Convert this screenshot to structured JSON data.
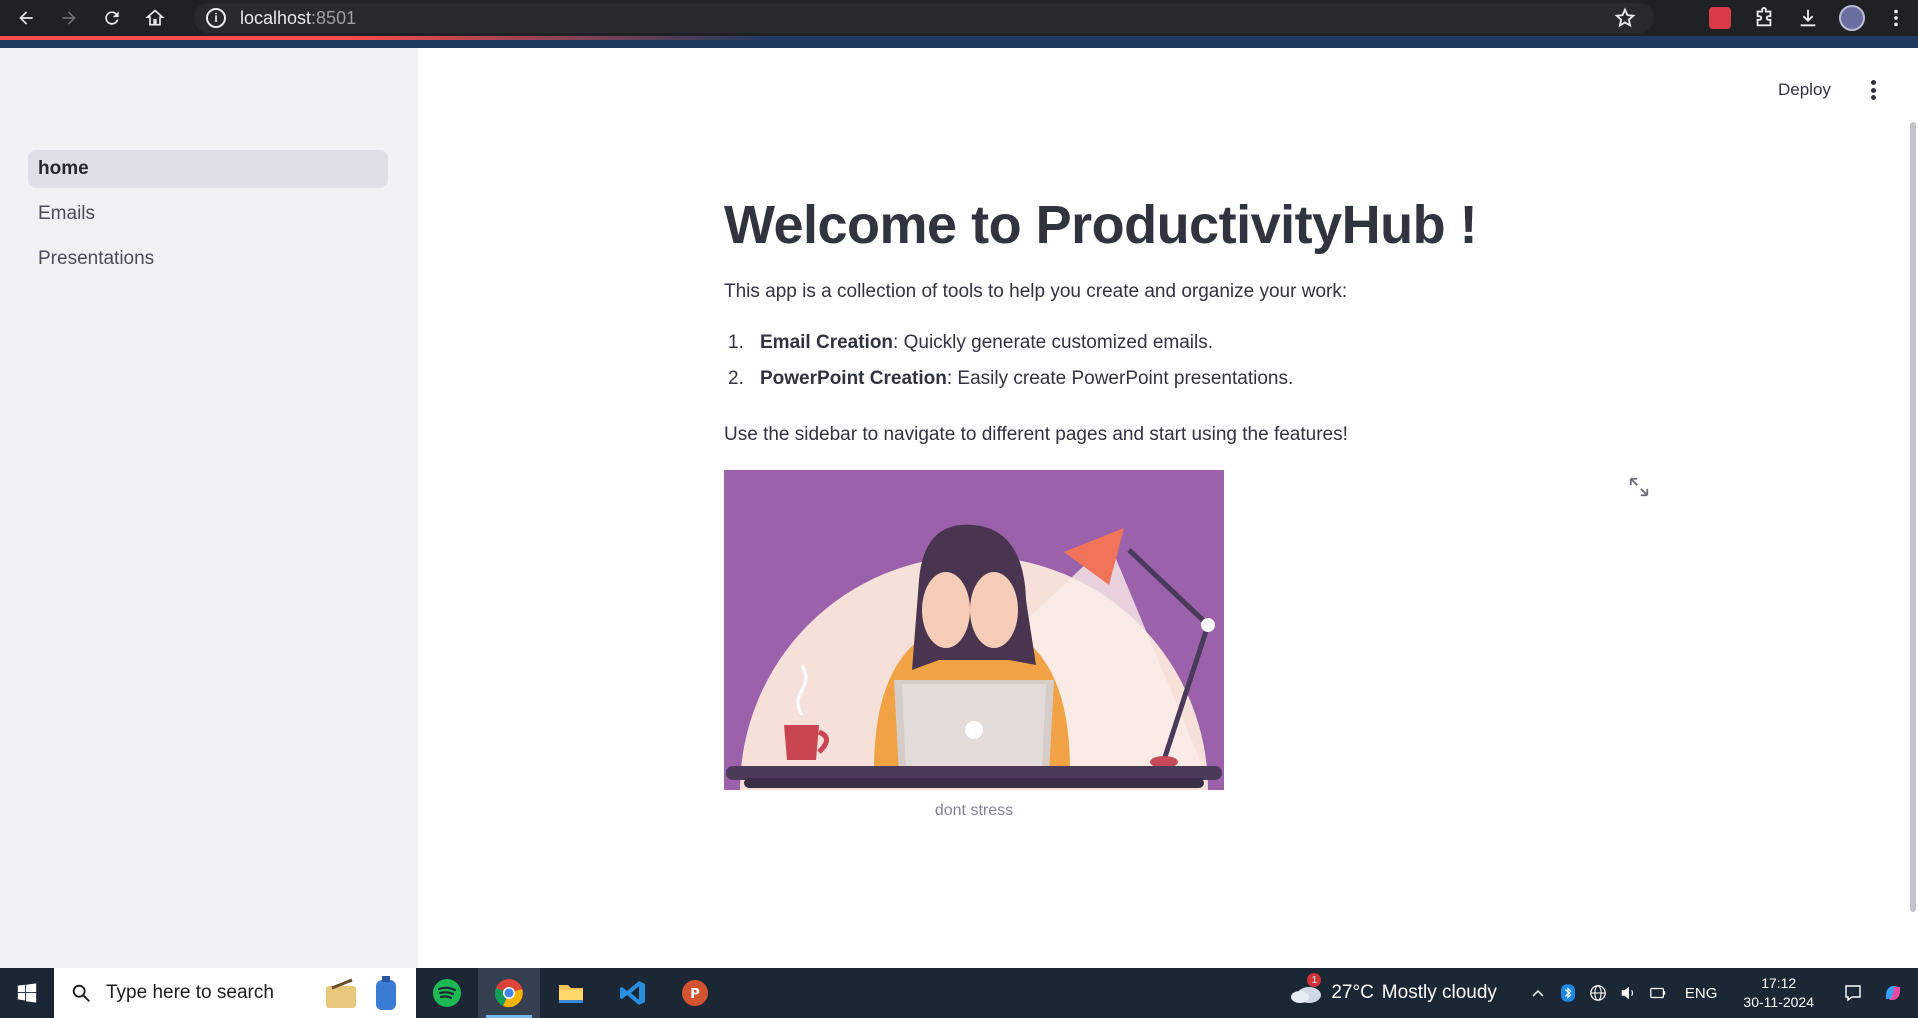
{
  "browser": {
    "url_host": "localhost",
    "url_port": ":8501"
  },
  "sidebar": {
    "items": [
      {
        "label": "home",
        "active": true
      },
      {
        "label": "Emails",
        "active": false
      },
      {
        "label": "Presentations",
        "active": false
      }
    ]
  },
  "header": {
    "deploy_label": "Deploy"
  },
  "main": {
    "title": "Welcome to ProductivityHub !",
    "intro": "This app is a collection of tools to help you create and organize your work:",
    "features": [
      {
        "num": "1.",
        "name": "Email Creation",
        "desc": ": Quickly generate customized emails."
      },
      {
        "num": "2.",
        "name": "PowerPoint Creation",
        "desc": ": Easily create PowerPoint presentations."
      }
    ],
    "outro": "Use the sidebar to navigate to different pages and start using the features!",
    "image_caption": "dont stress"
  },
  "taskbar": {
    "search_placeholder": "Type here to search",
    "weather_temp": "27°C",
    "weather_desc": "Mostly cloudy",
    "weather_badge": "1",
    "language": "ENG",
    "time": "17:12",
    "date": "30-11-2024"
  },
  "colors": {
    "accent_red": "#ff4b4b",
    "sidebar_bg": "#f0f2f6",
    "illustration_purple": "#9b62ab"
  }
}
